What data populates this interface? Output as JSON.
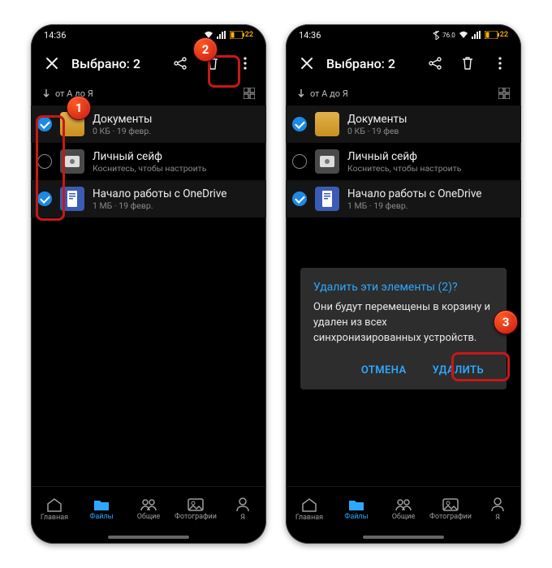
{
  "statusbar": {
    "time": "14:36",
    "battery": "22"
  },
  "appbar": {
    "title": "Выбрано: 2"
  },
  "sort": {
    "label": "от А до Я"
  },
  "files": [
    {
      "name": "Документы",
      "meta": "0 КБ · 19 февр.",
      "selected": true,
      "kind": "folder"
    },
    {
      "name": "Личный сейф",
      "meta": "Коснитесь, чтобы настроить",
      "selected": false,
      "kind": "vault"
    },
    {
      "name": "Начало работы с OneDrive",
      "meta": "1 МБ · 19 февр.",
      "selected": true,
      "kind": "doc"
    }
  ],
  "files_b": [
    {
      "name": "Документы",
      "meta": "0 КБ · 19 фев",
      "selected": true,
      "kind": "folder"
    },
    {
      "name": "Личный сейф",
      "meta": "Коснитесь, чтобы настроить",
      "selected": false,
      "kind": "vault"
    },
    {
      "name": "Начало работы с OneDrive",
      "meta": "1 МБ · 19 февр.",
      "selected": true,
      "kind": "doc"
    }
  ],
  "dialog": {
    "title": "Удалить эти элементы (2)?",
    "body": "Они будут перемещены в корзину и удален из всех синхронизированных устройств.",
    "cancel": "ОТМЕНА",
    "confirm": "УДАЛИТЬ"
  },
  "nav": {
    "home": "Главная",
    "files": "Файлы",
    "shared": "Общие",
    "photos": "Фотографии",
    "me": "Я"
  },
  "annotations": {
    "badge1": "1",
    "badge2": "2",
    "badge3": "3"
  }
}
